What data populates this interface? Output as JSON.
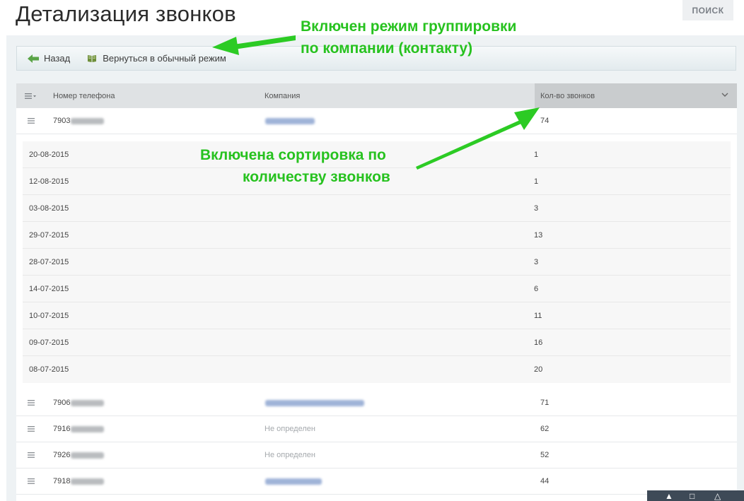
{
  "page": {
    "title": "Детализация звонков",
    "search_label": "ПОИСК"
  },
  "toolbar": {
    "back_label": "Назад",
    "normal_mode_label": "Вернуться в обычный режим"
  },
  "table": {
    "columns": {
      "phone": "Номер телефона",
      "company": "Компания",
      "count": "Кол-во звонков"
    },
    "first_row": {
      "phone": "7903",
      "count": "74"
    },
    "details": [
      {
        "date": "20-08-2015",
        "count": "1"
      },
      {
        "date": "12-08-2015",
        "count": "1"
      },
      {
        "date": "03-08-2015",
        "count": "3"
      },
      {
        "date": "29-07-2015",
        "count": "13"
      },
      {
        "date": "28-07-2015",
        "count": "3"
      },
      {
        "date": "14-07-2015",
        "count": "6"
      },
      {
        "date": "10-07-2015",
        "count": "11"
      },
      {
        "date": "09-07-2015",
        "count": "16"
      },
      {
        "date": "08-07-2015",
        "count": "20"
      }
    ],
    "rows": [
      {
        "phone": "7906",
        "company": "",
        "count": "71"
      },
      {
        "phone": "7916",
        "company": "Не определен",
        "count": "62"
      },
      {
        "phone": "7926",
        "company": "Не определен",
        "count": "52"
      },
      {
        "phone": "7918",
        "company": "",
        "count": "44"
      }
    ]
  },
  "annotations": {
    "grouping_line1": "Включен режим группировки",
    "grouping_line2": "по компании (контакту)",
    "sorting_line1": "Включена сортировка по",
    "sorting_line2": "количеству звонков"
  },
  "colors": {
    "annotation": "#27c21f",
    "header_active": "#c9ccce",
    "link": "#9fb3d8"
  }
}
